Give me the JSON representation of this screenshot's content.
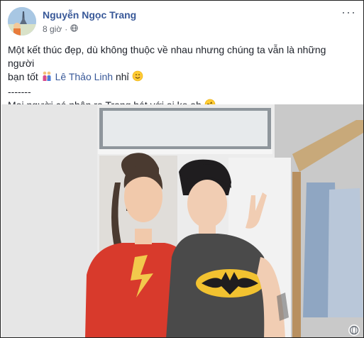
{
  "post": {
    "author": "Nguyễn Ngọc Trang",
    "time": "8 giờ",
    "more_label": "···",
    "line1": "Một kết thúc đẹp, dù không thuộc về nhau nhưng chúng ta vẫn là những người",
    "line2_prefix": "bạn tốt",
    "mention": "Lê Thảo Linh",
    "line2_suffix": "nhỉ",
    "separator": "-------",
    "line4": "Mọi người có nhận ra Trang hát với ai ko ah",
    "globe_icon": "globe-icon",
    "emojis": [
      "people-holding-hands",
      "smiling-face",
      "rolling-laughing-face"
    ]
  },
  "photo": {
    "description_icon": "photo-content"
  }
}
